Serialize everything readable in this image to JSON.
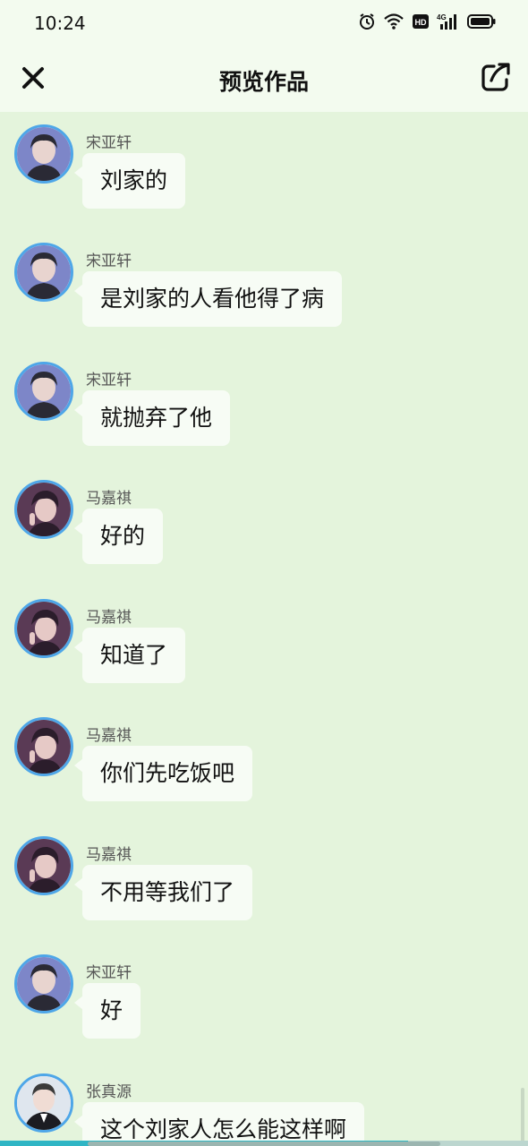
{
  "status_bar": {
    "time": "10:24",
    "icons": [
      "alarm-icon",
      "wifi-icon",
      "hd-icon",
      "4g-signal-icon",
      "battery-icon"
    ],
    "hd_label": "HD",
    "network_label": "4G"
  },
  "header": {
    "title": "预览作品",
    "close_icon": "close-icon",
    "share_icon": "share-icon"
  },
  "messages": [
    {
      "sender": "宋亚轩",
      "text": "刘家的",
      "avatar": "songyaxuan"
    },
    {
      "sender": "宋亚轩",
      "text": "是刘家的人看他得了病",
      "avatar": "songyaxuan"
    },
    {
      "sender": "宋亚轩",
      "text": "就抛弃了他",
      "avatar": "songyaxuan"
    },
    {
      "sender": "马嘉祺",
      "text": "好的",
      "avatar": "majiaqi"
    },
    {
      "sender": "马嘉祺",
      "text": "知道了",
      "avatar": "majiaqi"
    },
    {
      "sender": "马嘉祺",
      "text": "你们先吃饭吧",
      "avatar": "majiaqi"
    },
    {
      "sender": "马嘉祺",
      "text": "不用等我们了",
      "avatar": "majiaqi"
    },
    {
      "sender": "宋亚轩",
      "text": "好",
      "avatar": "songyaxuan"
    },
    {
      "sender": "张真源",
      "text": "这个刘家人怎么能这样啊",
      "avatar": "zhangzhenyuan"
    }
  ],
  "colors": {
    "background": "#e4f4dc",
    "header_bg": "#f3fbef",
    "bubble_bg": "#f7fcf5",
    "avatar_ring": "#4ea6e8",
    "progress": "#2fb5c4"
  }
}
